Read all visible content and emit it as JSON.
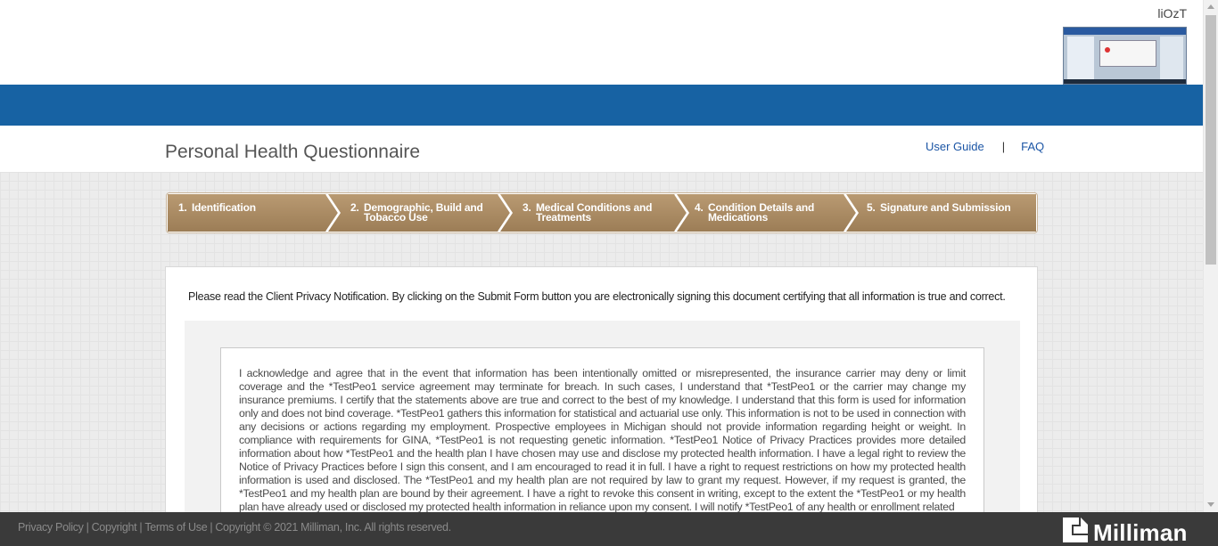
{
  "header": {
    "username": "liOzT",
    "thumbnail_icon": "screenshot-thumbnail"
  },
  "titlebar": {
    "title": "Personal Health Questionnaire",
    "links": [
      "User Guide",
      "FAQ"
    ],
    "separator": "|"
  },
  "steps": [
    {
      "num": "1.",
      "lines": [
        "Identification"
      ]
    },
    {
      "num": "2.",
      "lines": [
        "Demographic, Build and",
        "Tobacco Use"
      ]
    },
    {
      "num": "3.",
      "lines": [
        "Medical Conditions and",
        "Treatments"
      ]
    },
    {
      "num": "4.",
      "lines": [
        "Condition Details and",
        "Medications"
      ]
    },
    {
      "num": "5.",
      "lines": [
        "Signature and Submission"
      ]
    }
  ],
  "content": {
    "notice": "Please read the Client Privacy Notification. By clicking on the Submit Form button you are electronically signing this document certifying that all information is true and correct.",
    "legal_text": "I acknowledge and agree that in the event that information has been intentionally omitted or misrepresented, the insurance carrier may deny or limit coverage and the *TestPeo1 service agreement may terminate for breach. In such cases, I understand that *TestPeo1 or the carrier may change my insurance premiums. I certify that the statements above are true and correct to the best of my knowledge. I understand that this form is used for information only and does not bind coverage. *TestPeo1 gathers this information for statistical and actuarial use only. This information is not to be used in connection with any decisions or actions regarding my employment. Prospective employees in Michigan should not provide information regarding height or weight. In compliance with requirements for GINA, *TestPeo1 is not requesting genetic information. *TestPeo1 Notice of Privacy Practices provides more detailed information about how *TestPeo1 and the health plan I have chosen may use and disclose my protected health information. I have a legal right to review the Notice of Privacy Practices before I sign this consent, and I am encouraged to read it in full. I have a right to request restrictions on how my protected health information is used and disclosed. The *TestPeo1 and my health plan are not required by law to grant my request. However, if my request is granted, the *TestPeo1 and my health plan are bound by their agreement. I have a right to revoke this consent in writing, except to the extent the *TestPeo1 or my health plan have already used or disclosed my protected health information in reliance upon my consent. I will notify *TestPeo1 of any health or enrollment related"
  },
  "footer": {
    "links": [
      "Privacy Policy",
      "Copyright",
      "Terms of Use"
    ],
    "copyright": "Copyright © 2021 Milliman, Inc. All rights reserved.",
    "logo_text": "Milliman"
  },
  "colors": {
    "accent_blue": "#1762a3",
    "step_brown": "#a98a63",
    "footer_bg": "#3a3a3a"
  }
}
